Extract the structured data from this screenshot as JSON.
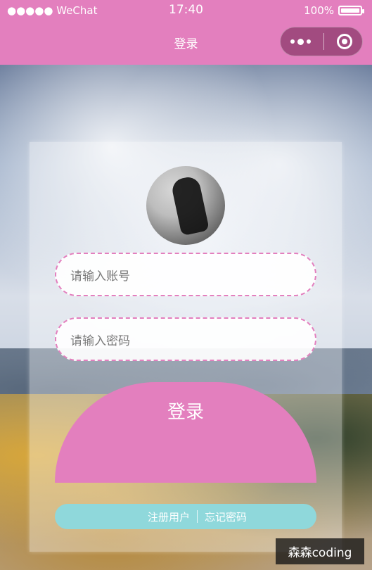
{
  "status_bar": {
    "carrier": "●●●●● WeChat",
    "time": "17:40",
    "battery": "100%"
  },
  "nav": {
    "title": "登录",
    "more_icon": "more-dots-icon",
    "close_icon": "close-circle-icon"
  },
  "login": {
    "username_placeholder": "请输入账号",
    "password_placeholder": "请输入密码",
    "login_button": "登录"
  },
  "links": {
    "register": "注册用户",
    "forgot": "忘记密码"
  },
  "watermark": {
    "text": "森森coding"
  },
  "colors": {
    "primary_pink": "#e37fbe",
    "links_bar": "#8fd8db"
  }
}
